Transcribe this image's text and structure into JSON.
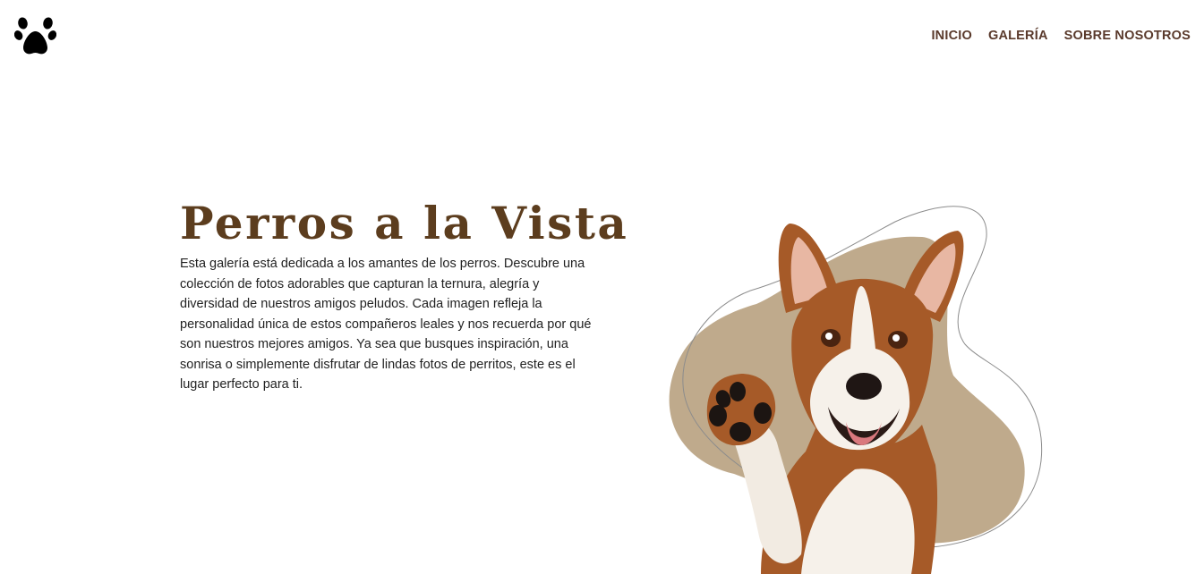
{
  "logo": {
    "icon": "paw-print-icon"
  },
  "nav": {
    "items": [
      {
        "label": "INICIO"
      },
      {
        "label": "GALERÍA"
      },
      {
        "label": "SOBRE NOSOTROS"
      }
    ]
  },
  "hero": {
    "title": "Perros a la Vista",
    "description": "Esta galería está dedicada a los amantes de los perros. Descubre una colección de fotos adorables que capturan la ternura, alegría y diversidad de nuestros amigos peludos. Cada imagen refleja la personalidad única de estos compañeros leales y nos recuerda por qué son nuestros mejores amigos. Ya sea que busques inspiración, una sonrisa o simplemente disfrutar de lindas fotos de perritos, este es el lugar perfecto para ti.",
    "image": "dog-waving-paw-photo"
  },
  "colors": {
    "nav_text": "#5a3a2c",
    "title": "#5c3d1e",
    "blob": "#bfaa8c",
    "dog_brown": "#a65a28",
    "dog_white": "#f6f1ea"
  }
}
